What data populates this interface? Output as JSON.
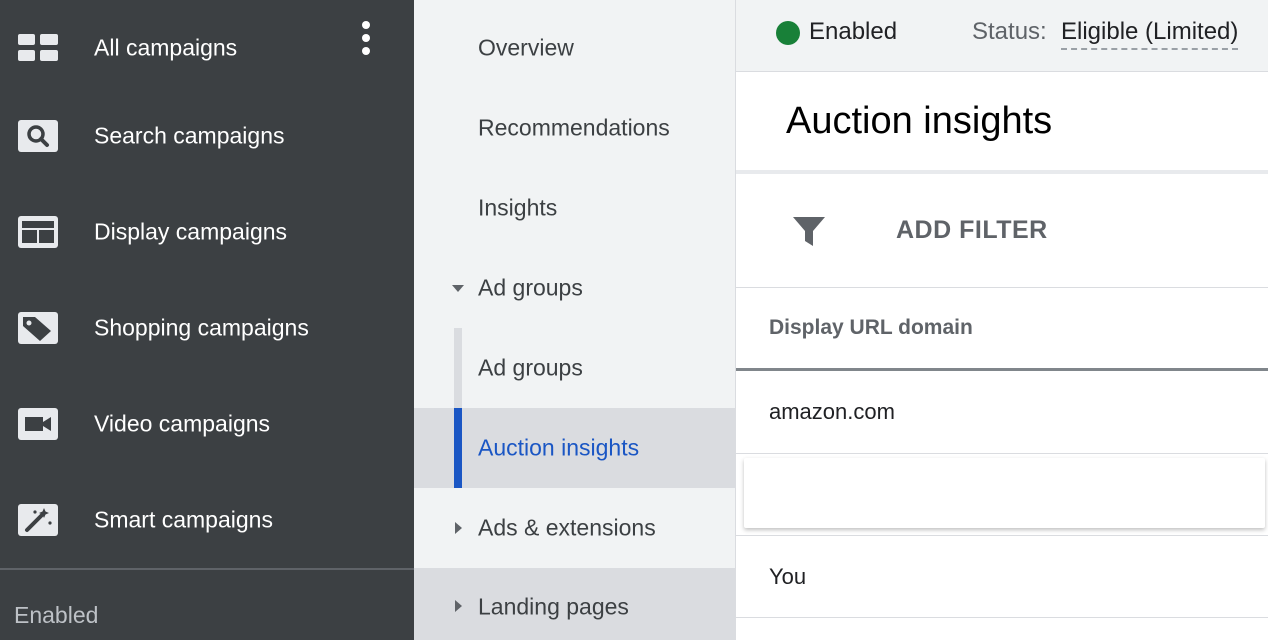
{
  "sidebar": {
    "items": [
      {
        "label": "All campaigns",
        "icon": "grid-icon"
      },
      {
        "label": "Search campaigns",
        "icon": "search-icon"
      },
      {
        "label": "Display campaigns",
        "icon": "display-icon"
      },
      {
        "label": "Shopping campaigns",
        "icon": "tag-icon"
      },
      {
        "label": "Video campaigns",
        "icon": "video-camera-icon"
      },
      {
        "label": "Smart campaigns",
        "icon": "magic-wand-icon"
      }
    ],
    "status": "Enabled"
  },
  "nav": {
    "items": [
      {
        "label": "Overview"
      },
      {
        "label": "Recommendations"
      },
      {
        "label": "Insights"
      },
      {
        "label": "Ad groups",
        "expanded": true
      },
      {
        "label": "Ad groups"
      },
      {
        "label": "Auction insights",
        "active": true
      },
      {
        "label": "Ads & extensions",
        "expanded": false
      },
      {
        "label": "Landing pages",
        "expanded": false
      }
    ]
  },
  "content": {
    "status_enabled": "Enabled",
    "status_prefix": "Status:",
    "status_value": "Eligible (Limited)",
    "title": "Auction insights",
    "filter_label": "ADD FILTER",
    "column_header": "Display URL domain",
    "rows": [
      "amazon.com",
      "",
      "You"
    ]
  },
  "colors": {
    "sidebar_bg": "#3c4043",
    "nav_bg": "#f1f3f4",
    "active_accent": "#1a56c4",
    "enabled_green": "#188038"
  }
}
